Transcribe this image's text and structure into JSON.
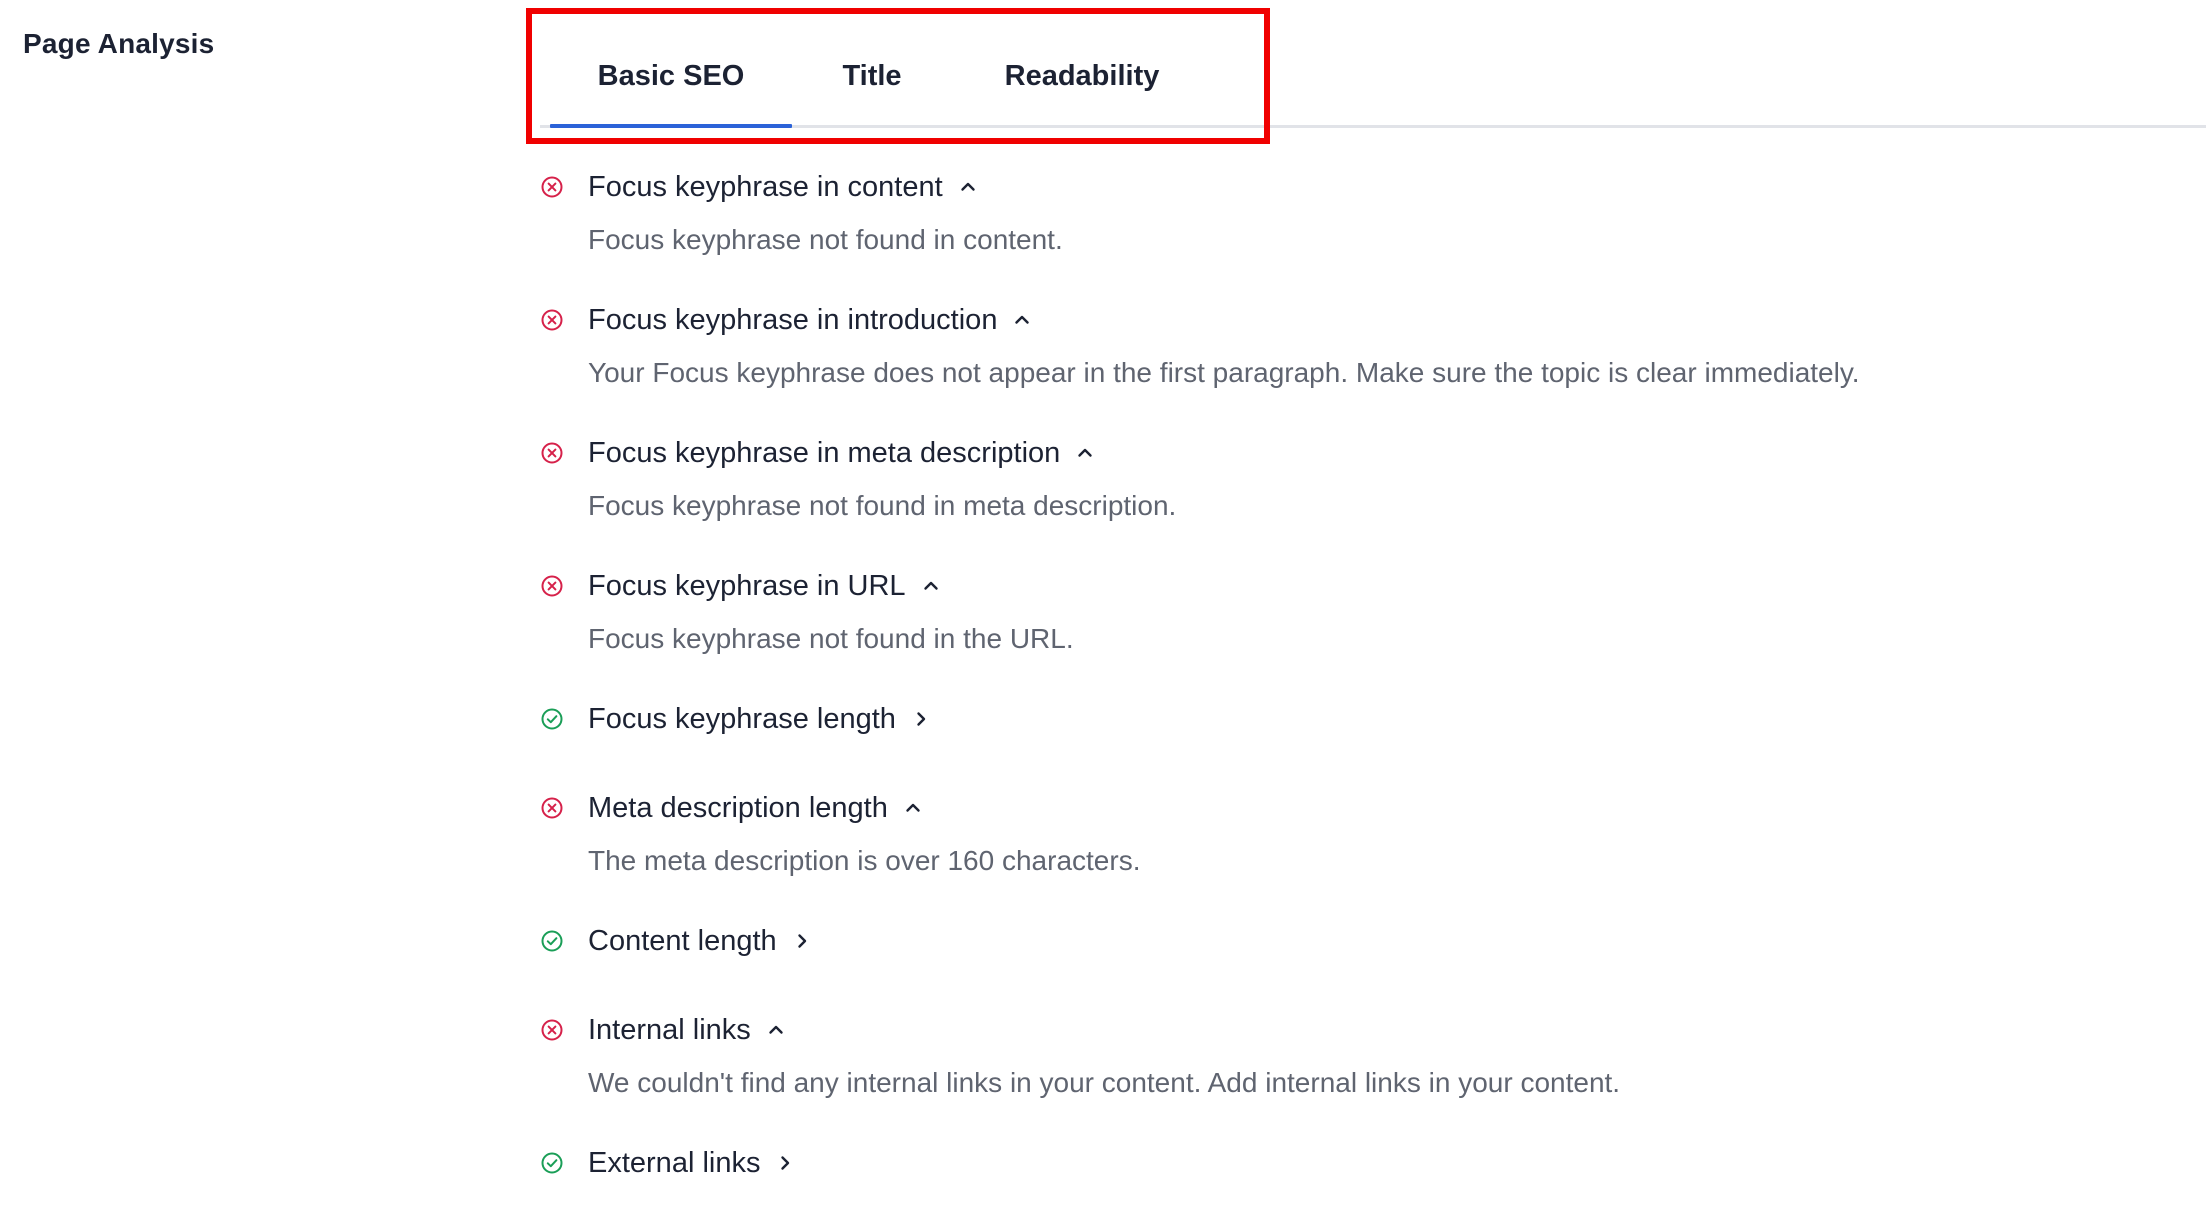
{
  "section": {
    "title": "Page Analysis"
  },
  "tabs": [
    {
      "label": "Basic SEO",
      "active": true
    },
    {
      "label": "Title",
      "active": false
    },
    {
      "label": "Readability",
      "active": false
    }
  ],
  "colors": {
    "fail": "#d6214a",
    "pass": "#1a9e57",
    "tab_active_underline": "#2b62d8",
    "highlight": "#f00000"
  },
  "results": [
    {
      "label": "Focus keyphrase in content",
      "status": "fail",
      "expanded": true,
      "message": "Focus keyphrase not found in content."
    },
    {
      "label": "Focus keyphrase in introduction",
      "status": "fail",
      "expanded": true,
      "message": "Your Focus keyphrase does not appear in the first paragraph. Make sure the topic is clear immediately."
    },
    {
      "label": "Focus keyphrase in meta description",
      "status": "fail",
      "expanded": true,
      "message": "Focus keyphrase not found in meta description."
    },
    {
      "label": "Focus keyphrase in URL",
      "status": "fail",
      "expanded": true,
      "message": "Focus keyphrase not found in the URL."
    },
    {
      "label": "Focus keyphrase length",
      "status": "pass",
      "expanded": false,
      "message": ""
    },
    {
      "label": "Meta description length",
      "status": "fail",
      "expanded": true,
      "message": "The meta description is over 160 characters."
    },
    {
      "label": "Content length",
      "status": "pass",
      "expanded": false,
      "message": ""
    },
    {
      "label": "Internal links",
      "status": "fail",
      "expanded": true,
      "message": "We couldn't find any internal links in your content. Add internal links in your content."
    },
    {
      "label": "External links",
      "status": "pass",
      "expanded": false,
      "message": ""
    }
  ]
}
